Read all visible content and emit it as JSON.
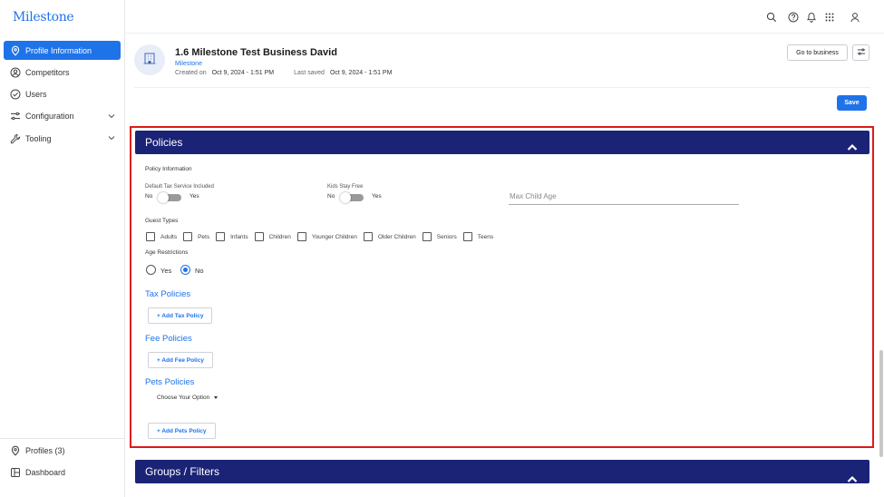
{
  "app": {
    "logo": "Milestone"
  },
  "sidebar": {
    "items": [
      {
        "label": "Profile Information",
        "icon": "location-pin-icon",
        "active": true
      },
      {
        "label": "Competitors",
        "icon": "user-circle-icon"
      },
      {
        "label": "Users",
        "icon": "check-circle-icon"
      },
      {
        "label": "Configuration",
        "icon": "sliders-icon"
      },
      {
        "label": "Tooling",
        "icon": "wrench-icon"
      }
    ],
    "bottom": [
      {
        "label": "Profiles (3)",
        "icon": "location-pin-icon"
      },
      {
        "label": "Dashboard",
        "icon": "dashboard-icon"
      }
    ]
  },
  "topbar": {
    "icons": [
      "search-icon",
      "help-icon",
      "bell-icon",
      "apps-grid-icon",
      "user-icon"
    ]
  },
  "business": {
    "title": "1.6 Milestone Test Business David",
    "org": "Milestone",
    "created_label": "Created on",
    "created_value": "Oct 9, 2024 - 1:51 PM",
    "saved_label": "Last saved",
    "saved_value": "Oct 9, 2024 - 1:51 PM",
    "go_button": "Go to business",
    "save_button": "Save"
  },
  "policies": {
    "title": "Policies",
    "info_label": "Policy Information",
    "default_tax": {
      "label": "Default Tax Service Included",
      "no": "No",
      "yes": "Yes"
    },
    "kids_stay": {
      "label": "Kids Stay Free",
      "no": "No",
      "yes": "Yes"
    },
    "max_child_placeholder": "Max Child Age",
    "guest_types_label": "Guest Types",
    "guest_types": [
      "Adults",
      "Pets",
      "Infants",
      "Children",
      "Younger Children",
      "Older Children",
      "Seniors",
      "Teens"
    ],
    "age_restrictions": {
      "label": "Age Restrictions",
      "yes": "Yes",
      "no": "No",
      "selected": "No"
    },
    "tax": {
      "title": "Tax Policies",
      "button": "+ Add Tax Policy"
    },
    "fee": {
      "title": "Fee Policies",
      "button": "+ Add Fee Policy"
    },
    "pets": {
      "title": "Pets Policies",
      "dropdown": "Choose Your Option",
      "button": "+ Add Pets Policy"
    }
  },
  "groups": {
    "title": "Groups / Filters"
  },
  "colors": {
    "accent": "#1f73e8",
    "header": "#1b2376",
    "highlight": "#e01919"
  }
}
